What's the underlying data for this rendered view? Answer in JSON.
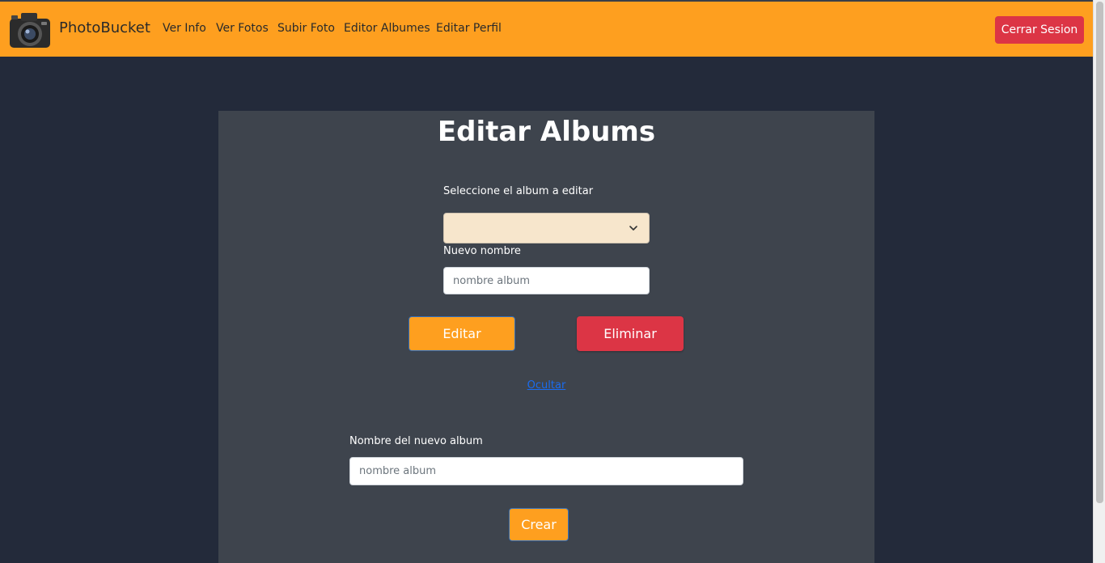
{
  "app": {
    "brand": "PhotoBucket"
  },
  "nav": {
    "links": [
      "Ver Info",
      "Ver Fotos",
      "Subir Foto",
      "Editor Albumes",
      "Editar Perfil"
    ],
    "logout_label": "Cerrar Sesion"
  },
  "edit": {
    "title": "Editar Albums",
    "select_label": "Seleccione el album a editar",
    "selected_value": "",
    "new_name_label": "Nuevo nombre",
    "new_name_placeholder": "nombre album",
    "edit_button": "Editar",
    "delete_button": "Eliminar",
    "hide_link": "Ocultar"
  },
  "create": {
    "label": "Nombre del nuevo album",
    "placeholder": "nombre album",
    "button": "Crear"
  },
  "colors": {
    "navbar": "#fe9f1f",
    "page_bg": "#232a3a",
    "panel_bg": "#3e444d",
    "danger": "#dc3545",
    "link": "#1a6cf0"
  },
  "icons": {
    "logo": "camera-icon",
    "select_arrow": "chevron-down-icon"
  }
}
